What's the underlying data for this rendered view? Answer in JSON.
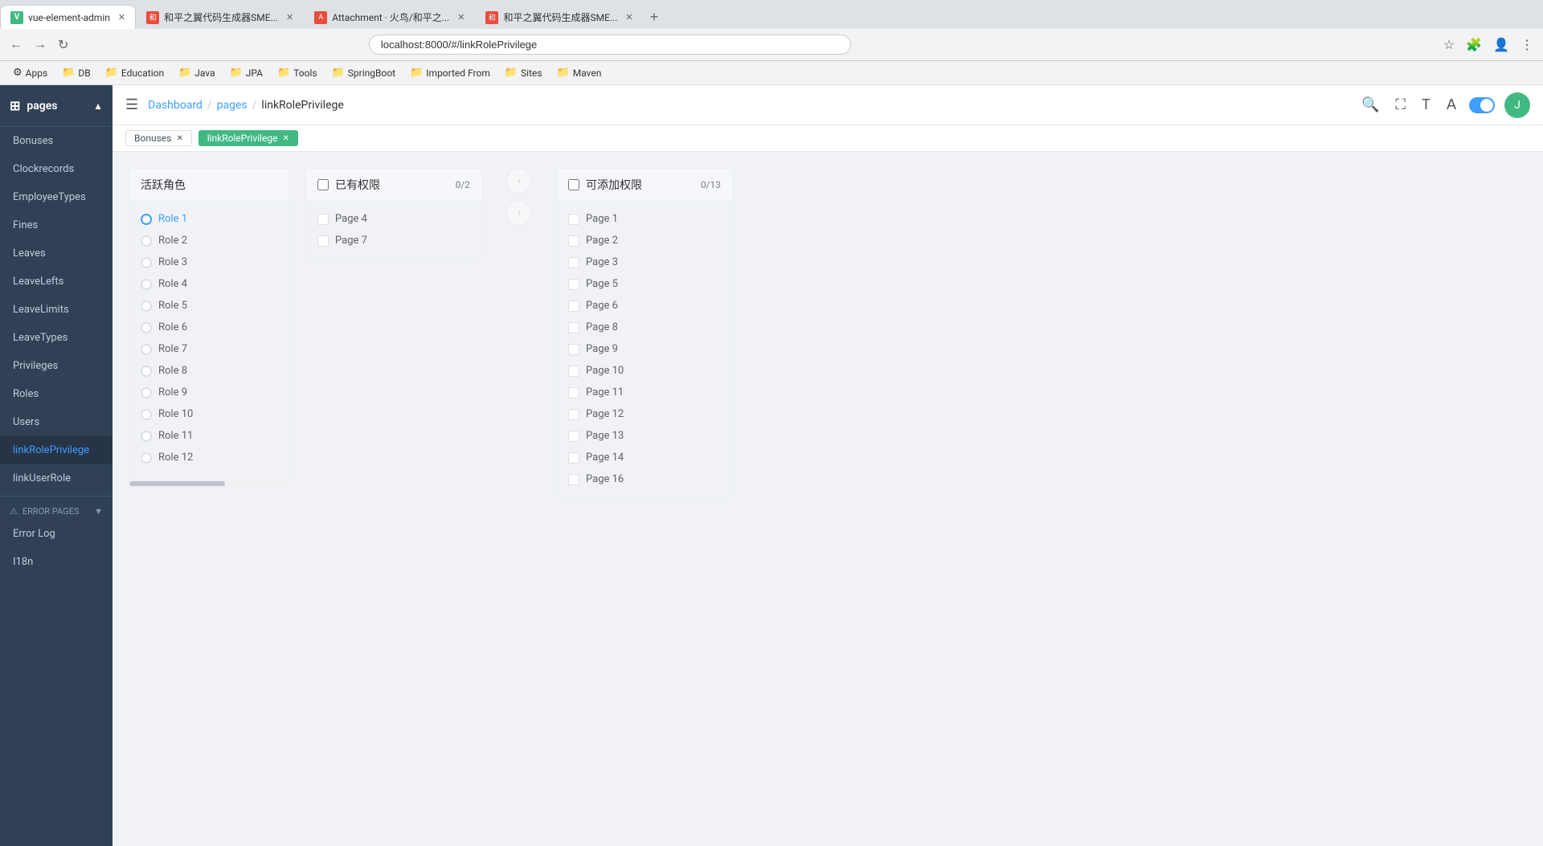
{
  "browser": {
    "tabs": [
      {
        "id": 1,
        "title": "vue-element-admin",
        "favicon_color": "#42b983",
        "favicon_text": "V",
        "active": true
      },
      {
        "id": 2,
        "title": "和平之翼代码生成器SME...",
        "favicon_color": "#e74c3c",
        "favicon_text": "和",
        "active": false
      },
      {
        "id": 3,
        "title": "Attachment · 火鸟/和平之...",
        "favicon_color": "#e74c3c",
        "favicon_text": "A",
        "active": false
      },
      {
        "id": 4,
        "title": "和平之翼代码生成器SME...",
        "favicon_color": "#e74c3c",
        "favicon_text": "和",
        "active": false
      }
    ],
    "address": "localhost:8000/#/linkRolePrivilege",
    "bookmarks": [
      {
        "label": "Apps",
        "icon": "⚙"
      },
      {
        "label": "DB",
        "icon": "🗄"
      },
      {
        "label": "Education",
        "icon": "📚"
      },
      {
        "label": "Java",
        "icon": "☕"
      },
      {
        "label": "JPA",
        "icon": "📦"
      },
      {
        "label": "Tools",
        "icon": "🔧"
      },
      {
        "label": "SpringBoot",
        "icon": "🌱"
      },
      {
        "label": "Imported From",
        "icon": "📂"
      },
      {
        "label": "Sites",
        "icon": "🌐"
      },
      {
        "label": "Maven",
        "icon": "📋"
      }
    ]
  },
  "sidebar": {
    "title": "pages",
    "items": [
      {
        "id": "bonuses",
        "label": "Bonuses"
      },
      {
        "id": "clockrecords",
        "label": "Clockrecords"
      },
      {
        "id": "employeetypes",
        "label": "EmployeeTypes"
      },
      {
        "id": "fines",
        "label": "Fines"
      },
      {
        "id": "leaves",
        "label": "Leaves"
      },
      {
        "id": "leavelefts",
        "label": "LeaveLefts"
      },
      {
        "id": "leavelimits",
        "label": "LeaveLimits"
      },
      {
        "id": "leavetypes",
        "label": "LeaveTypes"
      },
      {
        "id": "privileges",
        "label": "Privileges"
      },
      {
        "id": "roles",
        "label": "Roles"
      },
      {
        "id": "users",
        "label": "Users"
      },
      {
        "id": "linkroleprivilege",
        "label": "linkRolePrivilege",
        "active": true
      },
      {
        "id": "linkuserrole",
        "label": "linkUserRole"
      }
    ],
    "error_pages": {
      "label": "Error Pages",
      "items": [
        {
          "id": "error-log",
          "label": "Error Log"
        },
        {
          "id": "i18n",
          "label": "I18n"
        }
      ]
    }
  },
  "navbar": {
    "breadcrumbs": [
      "Dashboard",
      "pages",
      "linkRolePrivilege"
    ]
  },
  "tags": [
    {
      "label": "Bonuses",
      "active": false
    },
    {
      "label": "linkRolePrivilege",
      "active": true
    }
  ],
  "page": {
    "section_title": "活跃角色",
    "roles_panel": {
      "title": "活跃角色",
      "roles": [
        {
          "label": "Role 1",
          "selected": true
        },
        {
          "label": "Role 2"
        },
        {
          "label": "Role 3"
        },
        {
          "label": "Role 4"
        },
        {
          "label": "Role 5"
        },
        {
          "label": "Role 6"
        },
        {
          "label": "Role 7"
        },
        {
          "label": "Role 8"
        },
        {
          "label": "Role 9"
        },
        {
          "label": "Role 10"
        },
        {
          "label": "Role 11"
        },
        {
          "label": "Role 12"
        }
      ]
    },
    "existing_panel": {
      "title": "已有权限",
      "count": "0/2",
      "items": [
        {
          "label": "Page 4",
          "checked": false
        },
        {
          "label": "Page 7",
          "checked": false
        }
      ]
    },
    "available_panel": {
      "title": "可添加权限",
      "count": "0/13",
      "items": [
        {
          "label": "Page 1"
        },
        {
          "label": "Page 2"
        },
        {
          "label": "Page 3"
        },
        {
          "label": "Page 5"
        },
        {
          "label": "Page 6"
        },
        {
          "label": "Page 8"
        },
        {
          "label": "Page 9"
        },
        {
          "label": "Page 10"
        },
        {
          "label": "Page 11"
        },
        {
          "label": "Page 12"
        },
        {
          "label": "Page 13"
        },
        {
          "label": "Page 14"
        },
        {
          "label": "Page 16"
        }
      ]
    }
  }
}
